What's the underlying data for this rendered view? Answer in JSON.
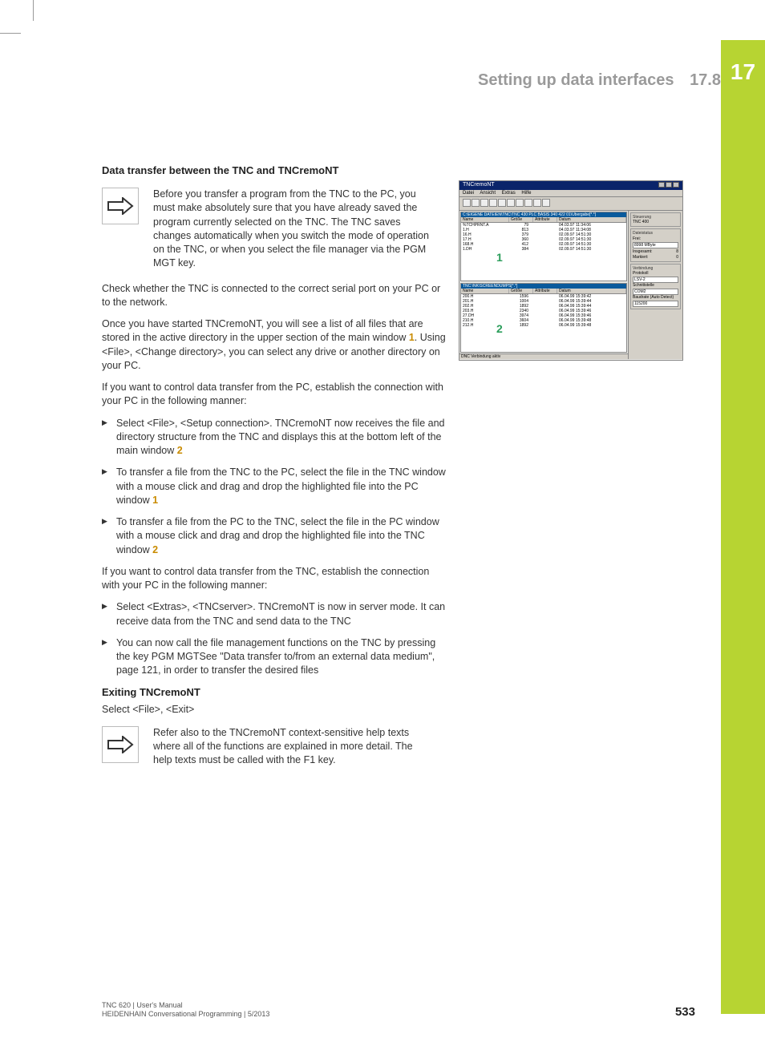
{
  "chapter_number": "17",
  "header": {
    "title": "Setting up data interfaces",
    "section_number": "17.8"
  },
  "section_heading": "Data transfer between the TNC and TNCremoNT",
  "note1": "Before you transfer a program from the TNC to the PC, you must make absolutely sure that you have already saved the program currently selected on the TNC. The TNC saves changes automatically when you switch the mode of operation on the TNC, or when you select the file manager via the PGM MGT key.",
  "para_check": "Check whether the TNC is connected to the correct serial port on your PC or to the network.",
  "para_started_a": "Once you have started TNCremoNT, you will see a list of all files that are stored in the active directory in the upper section of the main window ",
  "hl1": "1",
  "para_started_b": ". Using <File>, <Change directory>, you can select any drive or another directory on your PC.",
  "para_pc_control": "If you want to control data transfer from the PC, establish the connection with your PC in the following manner:",
  "steps_pc": {
    "s1a": "Select <File>, <Setup connection>. TNCremoNT now receives the file and directory structure from the TNC and displays this at the bottom left of the main window ",
    "s1b": "2",
    "s2a": "To transfer a file from the TNC to the PC, select the file in the TNC window with a mouse click and drag and drop the highlighted file into the PC window ",
    "s2b": "1",
    "s3a": "To transfer a file from the PC to the TNC, select the file in the PC window with a mouse click and drag and drop the highlighted file into the TNC window ",
    "s3b": "2"
  },
  "para_tnc_control": "If you want to control data transfer from the TNC, establish the connection with your PC in the following manner:",
  "steps_tnc": {
    "s1": "Select <Extras>, <TNCserver>. TNCremoNT is now in server mode. It can receive data from the TNC and send data to the TNC",
    "s2": "You can now call the file management functions on the TNC by pressing the key PGM MGTSee \"Data transfer to/from an external data medium\", page 121, in order to transfer the desired files"
  },
  "exit_heading": "Exiting TNCremoNT",
  "exit_body": "Select <File>, <Exit>",
  "note2": "Refer also to the TNCremoNT context-sensitive help texts where all of the functions are explained in more detail. The help texts must be called with the F1 key.",
  "screenshot": {
    "title": "TNCremoNT",
    "menu": [
      "Datei",
      "Ansicht",
      "Extras",
      "Hilfe"
    ],
    "path1": "C:\\EIGENE DATEIEN\\TNC\\TNC 430 PLC BASIS 340 422 01\\Übergabe[*.*]",
    "path2": "TNC:\\NK\\SCREENDUMPS[*.*]",
    "cols": [
      "Name",
      "Größe",
      "Attribute",
      "Datum"
    ],
    "pane1_num": "1",
    "pane2_num": "2",
    "rows1": [
      {
        "n": "%TCHPRNT.A",
        "s": "79",
        "d": "04.03.97 11:34:06"
      },
      {
        "n": "1.H",
        "s": "813",
        "d": "04.03.97 11:34:08"
      },
      {
        "n": "16.H",
        "s": "379",
        "d": "02.09.97 14:51:30"
      },
      {
        "n": "17.H",
        "s": "360",
        "d": "02.09.97 14:51:30"
      },
      {
        "n": "168.H",
        "s": "412",
        "d": "02.09.97 14:51:30"
      },
      {
        "n": "1.DH",
        "s": "384",
        "d": "02.09.97 14:51:30"
      }
    ],
    "rows2": [
      {
        "n": "200.H",
        "s": "1596",
        "d": "06.04.99 15:39:42"
      },
      {
        "n": "201.H",
        "s": "1004",
        "d": "06.04.99 15:39:44"
      },
      {
        "n": "202.H",
        "s": "1892",
        "d": "06.04.99 15:39:44"
      },
      {
        "n": "203.H",
        "s": "2340",
        "d": "06.04.99 15:39:46"
      },
      {
        "n": "27.DH",
        "s": "3974",
        "d": "06.04.99 15:39:46"
      },
      {
        "n": "210.H",
        "s": "3604",
        "d": "06.04.99 15:39:48"
      },
      {
        "n": "212.H",
        "s": "1892",
        "d": "06.04.99 15:39:48"
      }
    ],
    "status": "DNC Verbindung aktiv",
    "side": {
      "g1_lbl": "Steuerung",
      "g1_val": "TNC 400",
      "g2_lbl": "Dateistatus",
      "g2_frei": "Frei:",
      "g2_frei_v": "8998 MByte",
      "g2_ins": "Insgesamt:",
      "g2_ins_v": "8",
      "g2_mark": "Markiert:",
      "g2_mark_v": "0",
      "g3_lbl": "Verbindung",
      "g3_prot": "Protokoll",
      "g3_prot_v": "LSV-2",
      "g3_ss": "Schnittstelle",
      "g3_ss_v": "COM2",
      "g3_baud": "Baudrate (Auto Detect)",
      "g3_baud_v": "115200"
    }
  },
  "footer": {
    "line1": "TNC 620 | User's Manual",
    "line2": "HEIDENHAIN Conversational Programming | 5/2013",
    "page": "533"
  }
}
